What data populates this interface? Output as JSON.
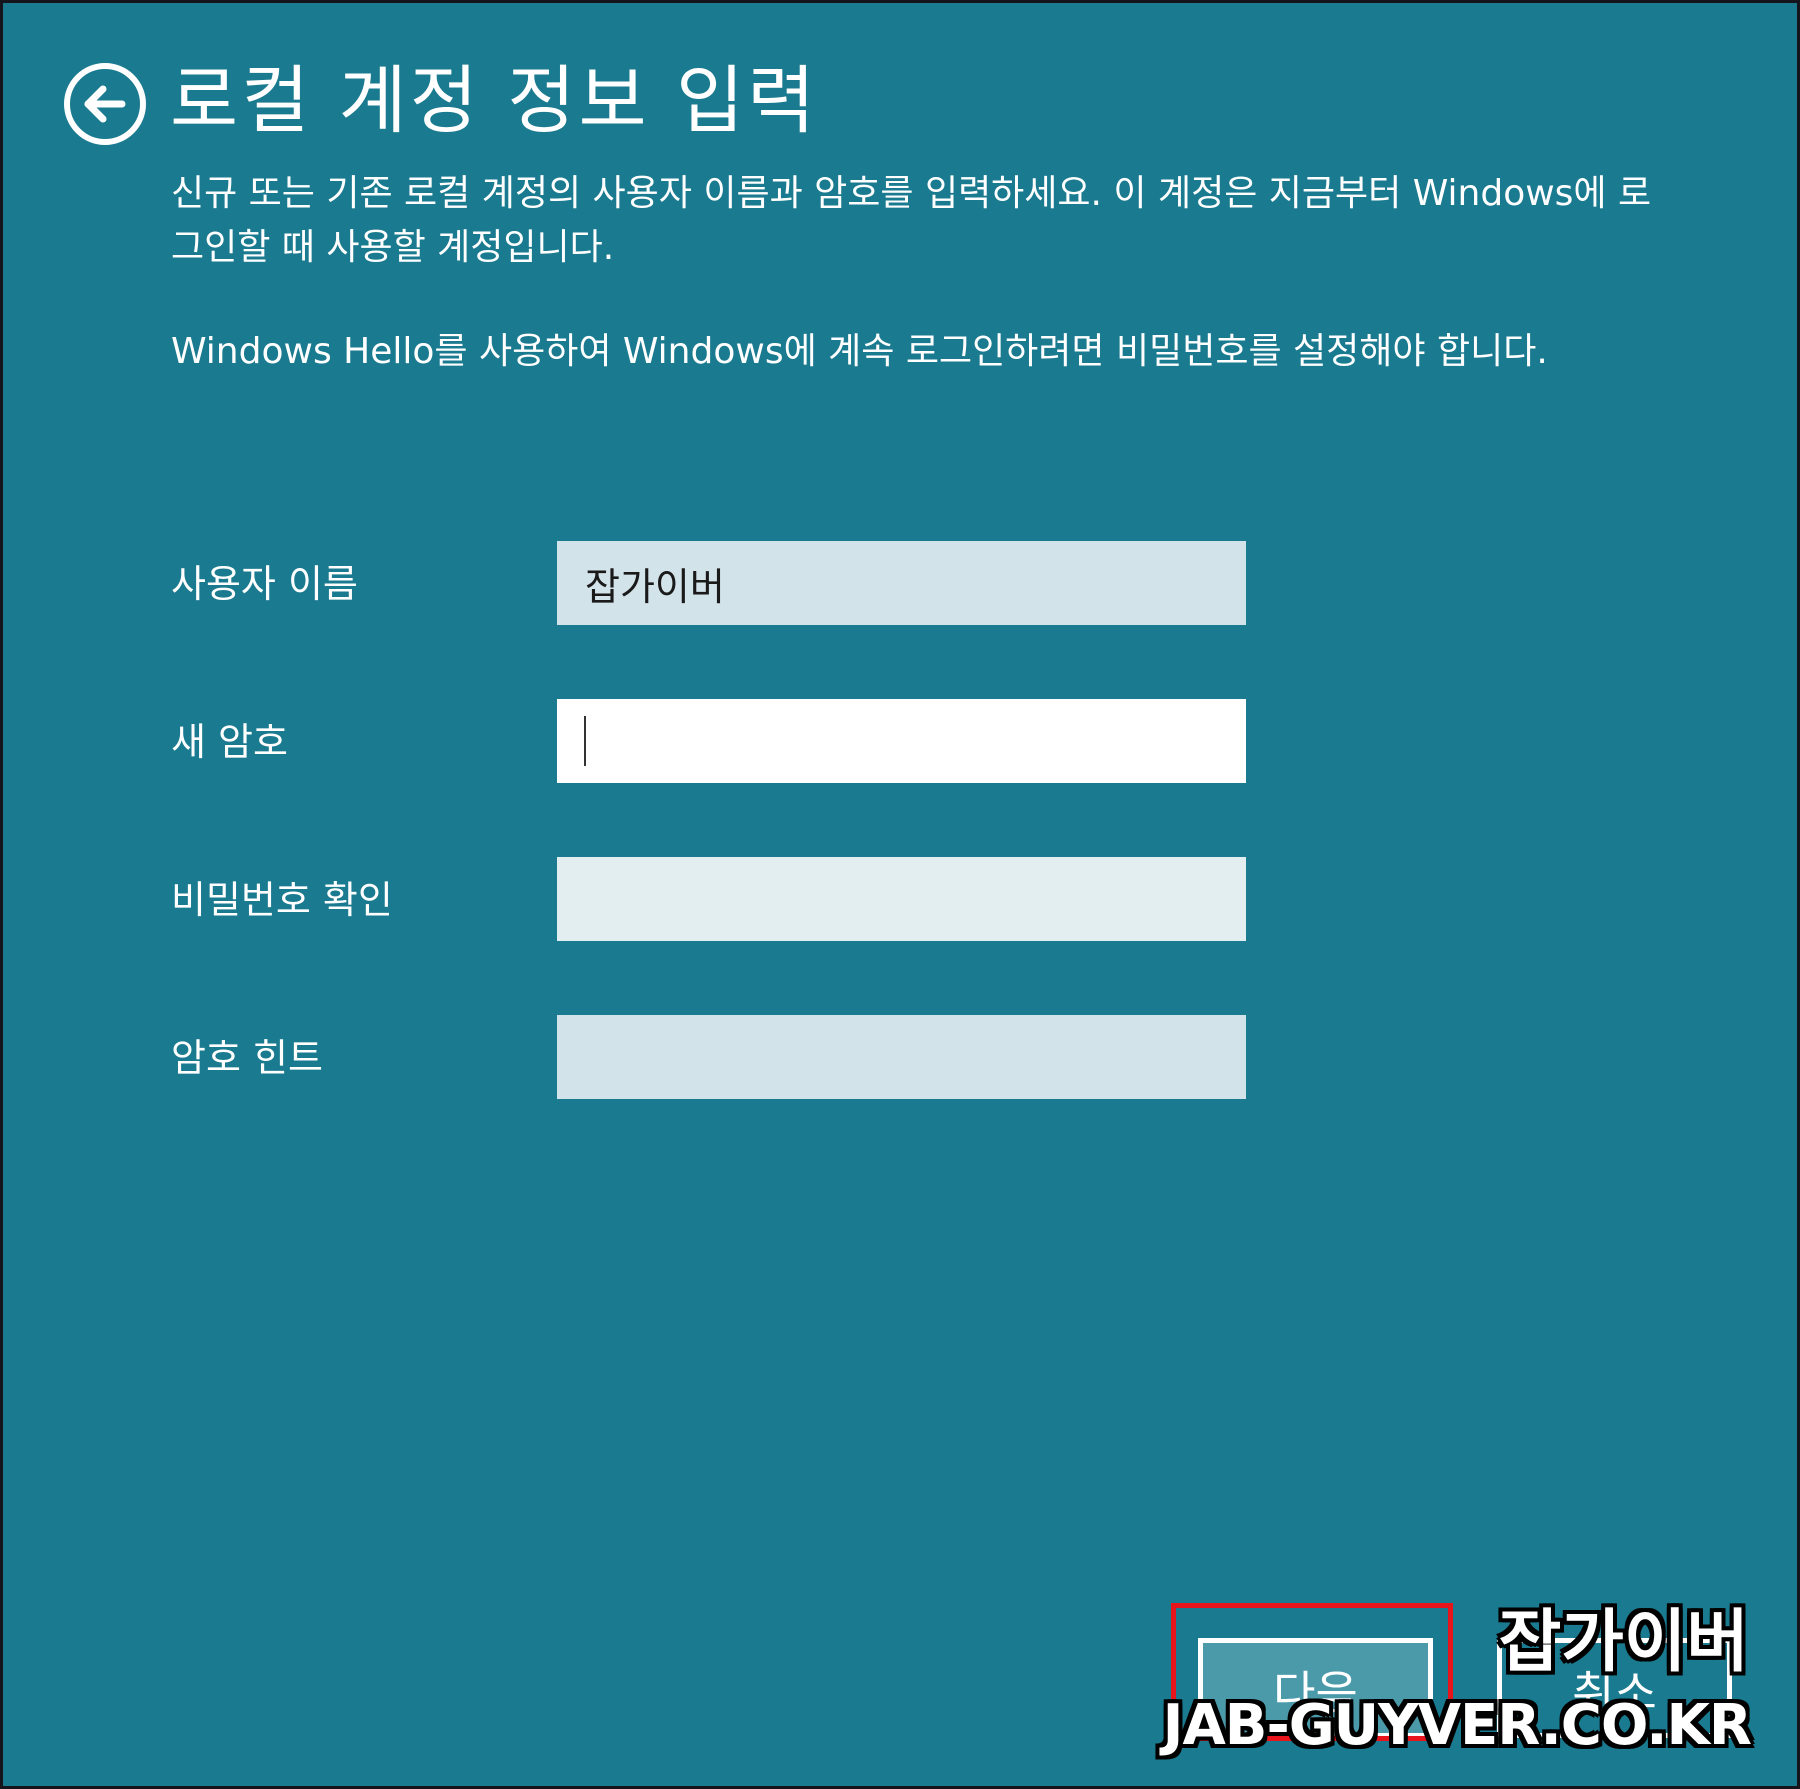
{
  "header": {
    "back_icon": "arrow-left-circle-icon",
    "title": "로컬 계정 정보 입력"
  },
  "description": {
    "paragraph1": "신규 또는 기존 로컬 계정의 사용자 이름과 암호를 입력하세요. 이 계정은 지금부터 Windows에 로그인할 때 사용할 계정입니다.",
    "paragraph2": "Windows Hello를 사용하여 Windows에 계속 로그인하려면 비밀번호를 설정해야 합니다."
  },
  "form": {
    "username_label": "사용자 이름",
    "username_value": "잡가이버",
    "new_password_label": "새 암호",
    "new_password_value": "",
    "confirm_password_label": "비밀번호 확인",
    "confirm_password_value": "",
    "hint_label": "암호 힌트",
    "hint_value": ""
  },
  "buttons": {
    "next_label": "다음",
    "cancel_label": "취소"
  },
  "watermark": {
    "name": "잡가이버",
    "url": "JAB-GUYVER.CO.KR"
  },
  "colors": {
    "background": "#1a7a8f",
    "highlight": "#e8141c"
  }
}
